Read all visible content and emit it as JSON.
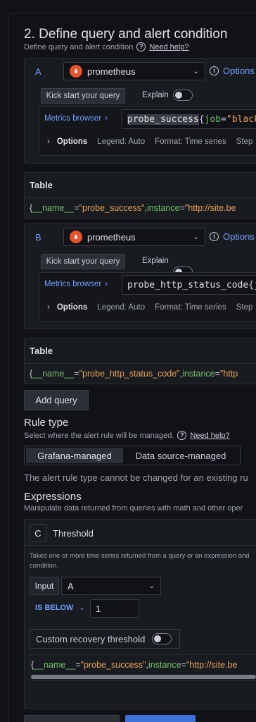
{
  "section": {
    "title": "2. Define query and alert condition",
    "subtitle": "Define query and alert condition",
    "help": "Need help?"
  },
  "queries": [
    {
      "letter": "A",
      "datasource": "prometheus",
      "options_label": "Options",
      "kick_start": "Kick start your query",
      "explain": "Explain",
      "metrics_browser": "Metrics browser",
      "expr_metric": "probe_success",
      "expr_brace": "{",
      "expr_key": "job",
      "expr_eq": "=",
      "expr_val": "\"blackb",
      "options": "Options",
      "legend": "Legend: Auto",
      "format": "Format: Time series",
      "step": "Step",
      "table_label": "Table",
      "series": {
        "open": "{",
        "k1": "__name__",
        "eq1": "=",
        "v1": "\"probe_success\"",
        "sep": ", ",
        "k2": "instance",
        "eq2": "=",
        "v2": "\"http://site.be"
      }
    },
    {
      "letter": "B",
      "datasource": "prometheus",
      "options_label": "Options",
      "kick_start": "Kick start your query",
      "explain": "Explain",
      "metrics_browser": "Metrics browser",
      "expr_metric": "probe_http_status_code",
      "expr_brace": "{",
      "expr_key": "jo",
      "options": "Options",
      "legend": "Legend: Auto",
      "format": "Format: Time series",
      "step": "Step",
      "table_label": "Table",
      "series": {
        "open": "{",
        "k1": "__name__",
        "eq1": "=",
        "v1": "\"probe_http_status_code\"",
        "sep": ", ",
        "k2": "instance",
        "eq2": "=",
        "v2": "\"http"
      }
    }
  ],
  "add_query": "Add query",
  "rule_type": {
    "title": "Rule type",
    "subtitle": "Select where the alert rule will be managed.",
    "help": "Need help?",
    "options": [
      "Grafana-managed",
      "Data source-managed"
    ],
    "note": "The alert rule type cannot be changed for an existing ru"
  },
  "expressions": {
    "title": "Expressions",
    "subtitle": "Manipulate data returned from queries with math and other oper",
    "card": {
      "letter": "C",
      "name": "Threshold",
      "desc": "Takes one or more time series returned from a query or an expression and",
      "desc2": "condition.",
      "input_label": "Input",
      "input_value": "A",
      "op": "IS BELOW",
      "threshold": "1",
      "recovery": "Custom recovery threshold",
      "series": {
        "open": "{",
        "k1": "__name__",
        "eq1": "=",
        "v1": "\"probe_success\"",
        "sep": ", ",
        "k2": "instance",
        "eq2": "=",
        "v2": "\"http://site.be"
      }
    }
  }
}
